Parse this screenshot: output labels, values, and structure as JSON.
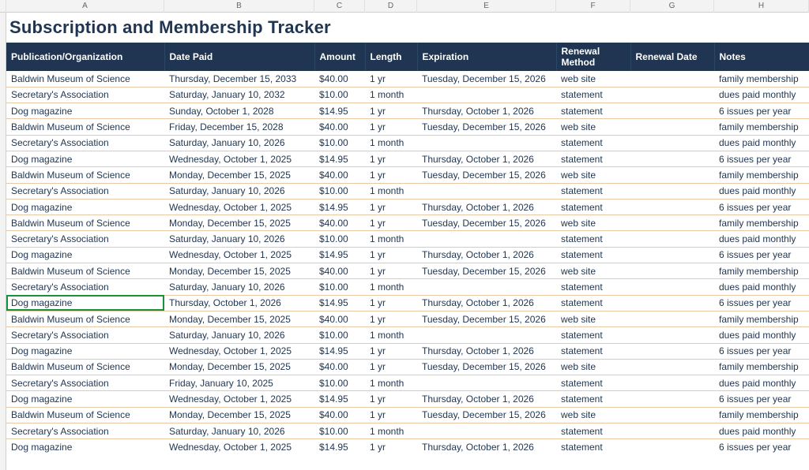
{
  "col_letters": [
    "",
    "A",
    "B",
    "C",
    "D",
    "E",
    "F",
    "G",
    "H"
  ],
  "title": "Subscription and Membership Tracker",
  "headers": {
    "org": "Publication/Organization",
    "date_paid": "Date Paid",
    "amount": "Amount",
    "length": "Length",
    "expiration": "Expiration",
    "renewal_method": "Renewal Method",
    "renewal_date": "Renewal Date",
    "notes": "Notes"
  },
  "rows": [
    {
      "org": "Baldwin Museum of Science",
      "date_paid": "Thursday, December 15, 2033",
      "amount": "$40.00",
      "length": "1 yr",
      "expiration": "Tuesday, December 15, 2026",
      "renewal_method": "web site",
      "renewal_date": "",
      "notes": "family membership"
    },
    {
      "org": "Secretary's Association",
      "date_paid": "Saturday, January 10, 2032",
      "amount": "$10.00",
      "length": "1 month",
      "expiration": "",
      "renewal_method": "statement",
      "renewal_date": "",
      "notes": "dues paid monthly"
    },
    {
      "org": "Dog magazine",
      "date_paid": "Sunday, October 1, 2028",
      "amount": "$14.95",
      "length": "1 yr",
      "expiration": "Thursday, October 1, 2026",
      "renewal_method": "statement",
      "renewal_date": "",
      "notes": "6 issues per year"
    },
    {
      "org": "Baldwin Museum of Science",
      "date_paid": "Friday, December 15, 2028",
      "amount": "$40.00",
      "length": "1 yr",
      "expiration": "Tuesday, December 15, 2026",
      "renewal_method": "web site",
      "renewal_date": "",
      "notes": "family membership"
    },
    {
      "org": "Secretary's Association",
      "date_paid": "Saturday, January 10, 2026",
      "amount": "$10.00",
      "length": "1 month",
      "expiration": "",
      "renewal_method": "statement",
      "renewal_date": "",
      "notes": "dues paid monthly"
    },
    {
      "org": "Dog magazine",
      "date_paid": "Wednesday, October 1, 2025",
      "amount": "$14.95",
      "length": "1 yr",
      "expiration": "Thursday, October 1, 2026",
      "renewal_method": "statement",
      "renewal_date": "",
      "notes": "6 issues per year"
    },
    {
      "org": "Baldwin Museum of Science",
      "date_paid": "Monday, December 15, 2025",
      "amount": "$40.00",
      "length": "1 yr",
      "expiration": "Tuesday, December 15, 2026",
      "renewal_method": "web site",
      "renewal_date": "",
      "notes": "family membership"
    },
    {
      "org": "Secretary's Association",
      "date_paid": "Saturday, January 10, 2026",
      "amount": "$10.00",
      "length": "1 month",
      "expiration": "",
      "renewal_method": "statement",
      "renewal_date": "",
      "notes": "dues paid monthly"
    },
    {
      "org": "Dog magazine",
      "date_paid": "Wednesday, October 1, 2025",
      "amount": "$14.95",
      "length": "1 yr",
      "expiration": "Thursday, October 1, 2026",
      "renewal_method": "statement",
      "renewal_date": "",
      "notes": "6 issues per year"
    },
    {
      "org": "Baldwin Museum of Science",
      "date_paid": "Monday, December 15, 2025",
      "amount": "$40.00",
      "length": "1 yr",
      "expiration": "Tuesday, December 15, 2026",
      "renewal_method": "web site",
      "renewal_date": "",
      "notes": "family membership"
    },
    {
      "org": "Secretary's Association",
      "date_paid": "Saturday, January 10, 2026",
      "amount": "$10.00",
      "length": "1 month",
      "expiration": "",
      "renewal_method": "statement",
      "renewal_date": "",
      "notes": "dues paid monthly"
    },
    {
      "org": "Dog magazine",
      "date_paid": "Wednesday, October 1, 2025",
      "amount": "$14.95",
      "length": "1 yr",
      "expiration": "Thursday, October 1, 2026",
      "renewal_method": "statement",
      "renewal_date": "",
      "notes": "6 issues per year"
    },
    {
      "org": "Baldwin Museum of Science",
      "date_paid": "Monday, December 15, 2025",
      "amount": "$40.00",
      "length": "1 yr",
      "expiration": "Tuesday, December 15, 2026",
      "renewal_method": "web site",
      "renewal_date": "",
      "notes": "family membership"
    },
    {
      "org": "Secretary's Association",
      "date_paid": "Saturday, January 10, 2026",
      "amount": "$10.00",
      "length": "1 month",
      "expiration": "",
      "renewal_method": "statement",
      "renewal_date": "",
      "notes": "dues paid monthly"
    },
    {
      "org": "Dog magazine",
      "date_paid": "Thursday, October 1, 2026",
      "amount": "$14.95",
      "length": "1 yr",
      "expiration": "Thursday, October 1, 2026",
      "renewal_method": "statement",
      "renewal_date": "",
      "notes": "6 issues per year",
      "selected": true
    },
    {
      "org": "Baldwin Museum of Science",
      "date_paid": "Monday, December 15, 2025",
      "amount": "$40.00",
      "length": "1 yr",
      "expiration": "Tuesday, December 15, 2026",
      "renewal_method": "web site",
      "renewal_date": "",
      "notes": "family membership"
    },
    {
      "org": "Secretary's Association",
      "date_paid": "Saturday, January 10, 2026",
      "amount": "$10.00",
      "length": "1 month",
      "expiration": "",
      "renewal_method": "statement",
      "renewal_date": "",
      "notes": "dues paid monthly"
    },
    {
      "org": "Dog magazine",
      "date_paid": "Wednesday, October 1, 2025",
      "amount": "$14.95",
      "length": "1 yr",
      "expiration": "Thursday, October 1, 2026",
      "renewal_method": "statement",
      "renewal_date": "",
      "notes": "6 issues per year"
    },
    {
      "org": "Baldwin Museum of Science",
      "date_paid": "Monday, December 15, 2025",
      "amount": "$40.00",
      "length": "1 yr",
      "expiration": "Tuesday, December 15, 2026",
      "renewal_method": "web site",
      "renewal_date": "",
      "notes": "family membership"
    },
    {
      "org": "Secretary's Association",
      "date_paid": "Friday, January 10, 2025",
      "amount": "$10.00",
      "length": "1 month",
      "expiration": "",
      "renewal_method": "statement",
      "renewal_date": "",
      "notes": "dues paid monthly"
    },
    {
      "org": "Dog magazine",
      "date_paid": "Wednesday, October 1, 2025",
      "amount": "$14.95",
      "length": "1 yr",
      "expiration": "Thursday, October 1, 2026",
      "renewal_method": "statement",
      "renewal_date": "",
      "notes": "6 issues per year"
    },
    {
      "org": "Baldwin Museum of Science",
      "date_paid": "Monday, December 15, 2025",
      "amount": "$40.00",
      "length": "1 yr",
      "expiration": "Tuesday, December 15, 2026",
      "renewal_method": "web site",
      "renewal_date": "",
      "notes": "family membership"
    },
    {
      "org": "Secretary's Association",
      "date_paid": "Saturday, January 10, 2026",
      "amount": "$10.00",
      "length": "1 month",
      "expiration": "",
      "renewal_method": "statement",
      "renewal_date": "",
      "notes": "dues paid monthly"
    },
    {
      "org": "Dog magazine",
      "date_paid": "Wednesday, October 1, 2025",
      "amount": "$14.95",
      "length": "1 yr",
      "expiration": "Thursday, October 1, 2026",
      "renewal_method": "statement",
      "renewal_date": "",
      "notes": "6 issues per year"
    }
  ]
}
